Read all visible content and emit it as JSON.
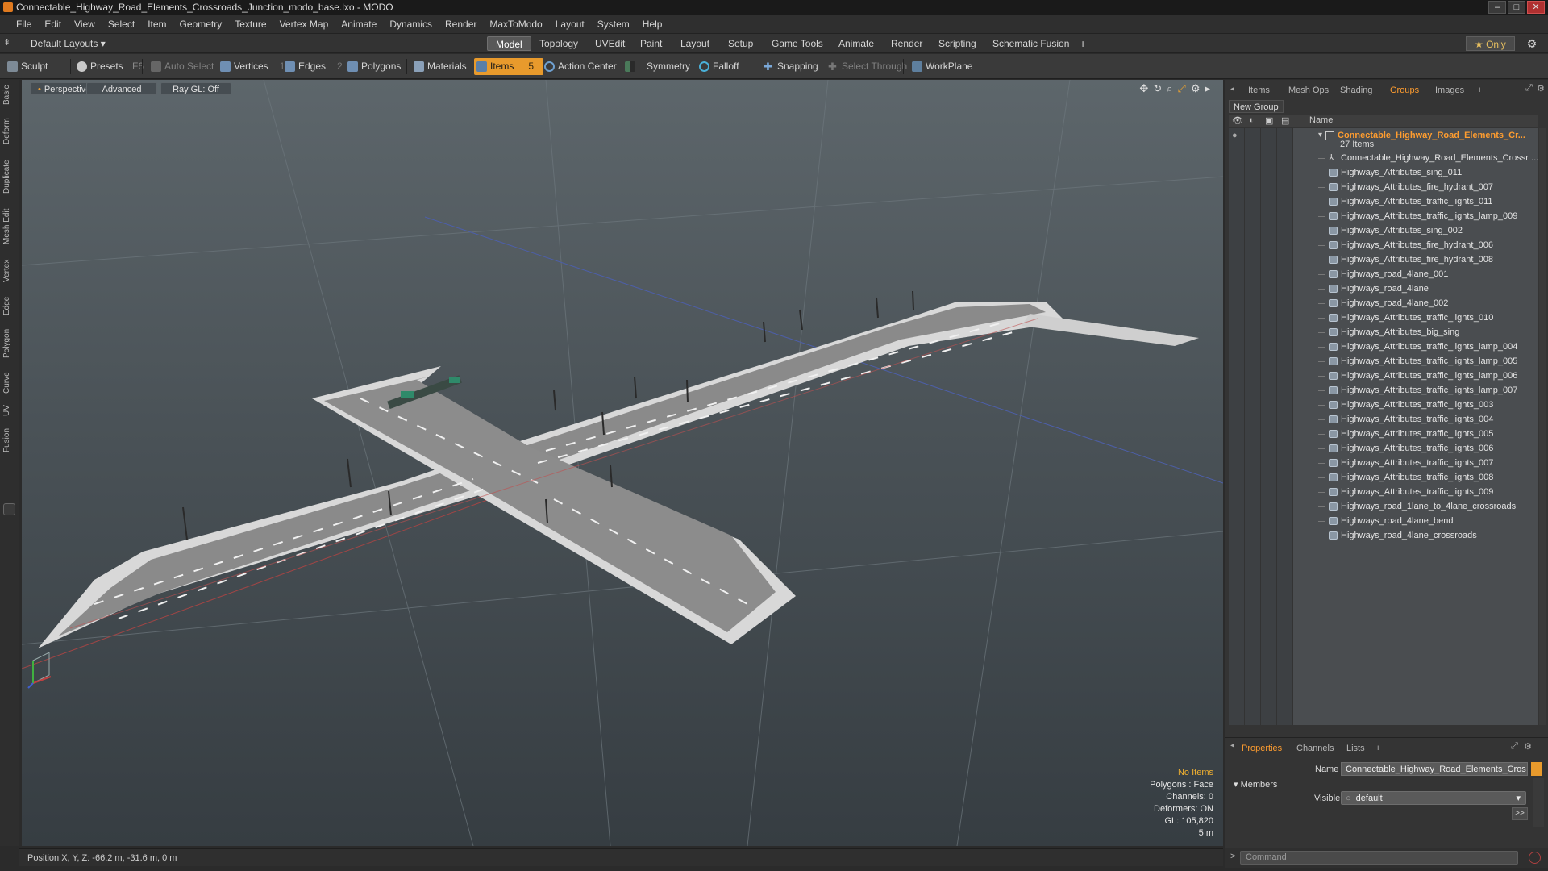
{
  "window": {
    "title": "Connectable_Highway_Road_Elements_Crossroads_Junction_modo_base.lxo - MODO",
    "buttons": {
      "minimize": "–",
      "maximize": "□",
      "close": "✕"
    }
  },
  "menu": [
    "File",
    "Edit",
    "View",
    "Select",
    "Item",
    "Geometry",
    "Texture",
    "Vertex Map",
    "Animate",
    "Dynamics",
    "Render",
    "MaxToModo",
    "Layout",
    "System",
    "Help"
  ],
  "layout_bar": {
    "layouts_label": "Default Layouts ▾",
    "tabs": [
      "Model",
      "Topology",
      "UVEdit",
      "Paint",
      "Layout",
      "Setup",
      "Game Tools",
      "Animate",
      "Render",
      "Scripting",
      "Schematic Fusion"
    ],
    "active_tab": "Model",
    "add": "+",
    "only_label": "★ Only"
  },
  "toolbar": {
    "sculpt": "Sculpt",
    "presets": "Presets",
    "presets_key": "F6",
    "auto_select": "Auto Select",
    "vertices": "Vertices",
    "vertices_count": "1",
    "edges": "Edges",
    "edges_count": "2",
    "polygons": "Polygons",
    "materials": "Materials",
    "items": "Items",
    "items_count": "5",
    "action_center": "Action Center",
    "symmetry": "Symmetry",
    "falloff": "Falloff",
    "snapping": "Snapping",
    "select_through": "Select Through",
    "workplane": "WorkPlane"
  },
  "left_tabs": [
    "Basic",
    "Deform",
    "Duplicate",
    "Mesh Edit",
    "Vertex",
    "Edge",
    "Polygon",
    "Curve",
    "UV",
    "Fusion"
  ],
  "viewport": {
    "view_mode": "Perspective",
    "shading": "Advanced",
    "raygl": "Ray GL: Off",
    "info": {
      "selection": "No Items",
      "polygons": "Polygons : Face",
      "channels": "Channels: 0",
      "deformers": "Deformers: ON",
      "gl": "GL: 105,820",
      "scale": "5 m"
    }
  },
  "status": {
    "position": "Position X, Y, Z:  -66.2 m, -31.6 m, 0 m"
  },
  "right_panel": {
    "tabs": [
      "Items",
      "Mesh Ops",
      "Shading",
      "Groups",
      "Images",
      "+"
    ],
    "active_tab": "Groups",
    "new_group": "New Group",
    "column_name": "Name",
    "group": {
      "name": "Connectable_Highway_Road_Elements_Cr...",
      "count": "27 Items",
      "items": [
        "Connectable_Highway_Road_Elements_Crossr ...",
        "Highways_Attributes_sing_011",
        "Highways_Attributes_fire_hydrant_007",
        "Highways_Attributes_traffic_lights_011",
        "Highways_Attributes_traffic_lights_lamp_009",
        "Highways_Attributes_sing_002",
        "Highways_Attributes_fire_hydrant_006",
        "Highways_Attributes_fire_hydrant_008",
        "Highways_road_4lane_001",
        "Highways_road_4lane",
        "Highways_road_4lane_002",
        "Highways_Attributes_traffic_lights_010",
        "Highways_Attributes_big_sing",
        "Highways_Attributes_traffic_lights_lamp_004",
        "Highways_Attributes_traffic_lights_lamp_005",
        "Highways_Attributes_traffic_lights_lamp_006",
        "Highways_Attributes_traffic_lights_lamp_007",
        "Highways_Attributes_traffic_lights_003",
        "Highways_Attributes_traffic_lights_004",
        "Highways_Attributes_traffic_lights_005",
        "Highways_Attributes_traffic_lights_006",
        "Highways_Attributes_traffic_lights_007",
        "Highways_Attributes_traffic_lights_008",
        "Highways_Attributes_traffic_lights_009",
        "Highways_road_1lane_to_4lane_crossroads",
        "Highways_road_4lane_bend",
        "Highways_road_4lane_crossroads"
      ]
    }
  },
  "properties": {
    "tabs": [
      "Properties",
      "Channels",
      "Lists",
      "+"
    ],
    "active_tab": "Properties",
    "name_label": "Name",
    "name_value": "Connectable_Highway_Road_Elements_Cros",
    "members_label": "Members",
    "visible_label": "Visible",
    "visible_value": "default",
    "more": ">>"
  },
  "command": {
    "placeholder": "Command",
    "prompt": ">"
  },
  "colors": {
    "accent": "#e89a2c",
    "group_name": "#ff9d2f",
    "viewport_top": "#5d666b",
    "viewport_bottom": "#363d42"
  }
}
